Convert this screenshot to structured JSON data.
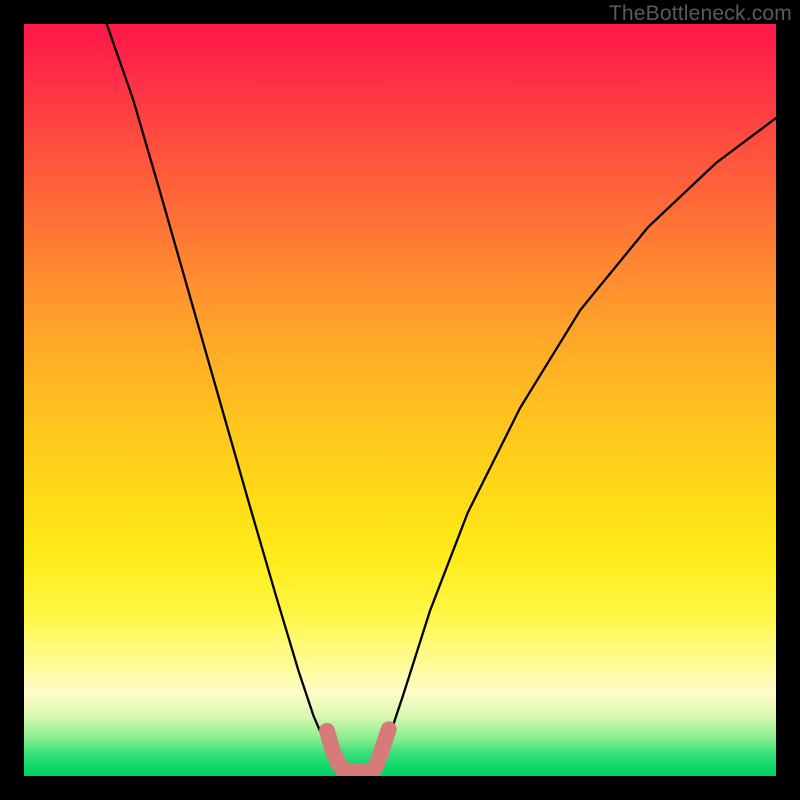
{
  "watermark": "TheBottleneck.com",
  "chart_data": {
    "type": "line",
    "title": "",
    "xlabel": "",
    "ylabel": "",
    "xlim": [
      0,
      100
    ],
    "ylim": [
      0,
      100
    ],
    "grid": false,
    "legend": false,
    "note": "Two V-shaped curves converging near the bottom center region; x and y expressed as percentages of plot width/height.",
    "series": [
      {
        "name": "left-branch",
        "x": [
          11.0,
          14.5,
          18.0,
          22.0,
          26.0,
          30.0,
          33.5,
          36.5,
          38.5,
          40.0,
          41.2,
          42.0,
          42.5
        ],
        "y": [
          100.0,
          90.0,
          78.0,
          64.0,
          50.0,
          36.0,
          24.0,
          14.0,
          8.0,
          4.5,
          2.5,
          1.3,
          0.7
        ]
      },
      {
        "name": "right-branch",
        "x": [
          46.5,
          47.2,
          48.5,
          50.5,
          54.0,
          59.0,
          66.0,
          74.0,
          83.0,
          92.0,
          100.0
        ],
        "y": [
          0.7,
          2.0,
          5.0,
          11.0,
          22.0,
          35.0,
          49.0,
          62.0,
          73.0,
          81.5,
          87.5
        ]
      }
    ],
    "highlight": {
      "name": "bottom-highlight",
      "color": "#d77b7a",
      "segments": [
        {
          "x": [
            40.3,
            41.0,
            41.8,
            42.5
          ],
          "y": [
            6.0,
            3.5,
            1.7,
            0.9
          ]
        },
        {
          "x": [
            42.5,
            43.7,
            45.0,
            46.3
          ],
          "y": [
            0.7,
            0.6,
            0.6,
            0.7
          ]
        },
        {
          "x": [
            46.5,
            47.0,
            47.7,
            48.5
          ],
          "y": [
            0.8,
            1.8,
            3.8,
            6.2
          ]
        }
      ]
    },
    "background_gradient": {
      "stops": [
        {
          "pos": 0.0,
          "color": "#ff1848"
        },
        {
          "pos": 0.5,
          "color": "#ffca1c"
        },
        {
          "pos": 0.85,
          "color": "#fffb88"
        },
        {
          "pos": 1.0,
          "color": "#08d060"
        }
      ]
    }
  }
}
